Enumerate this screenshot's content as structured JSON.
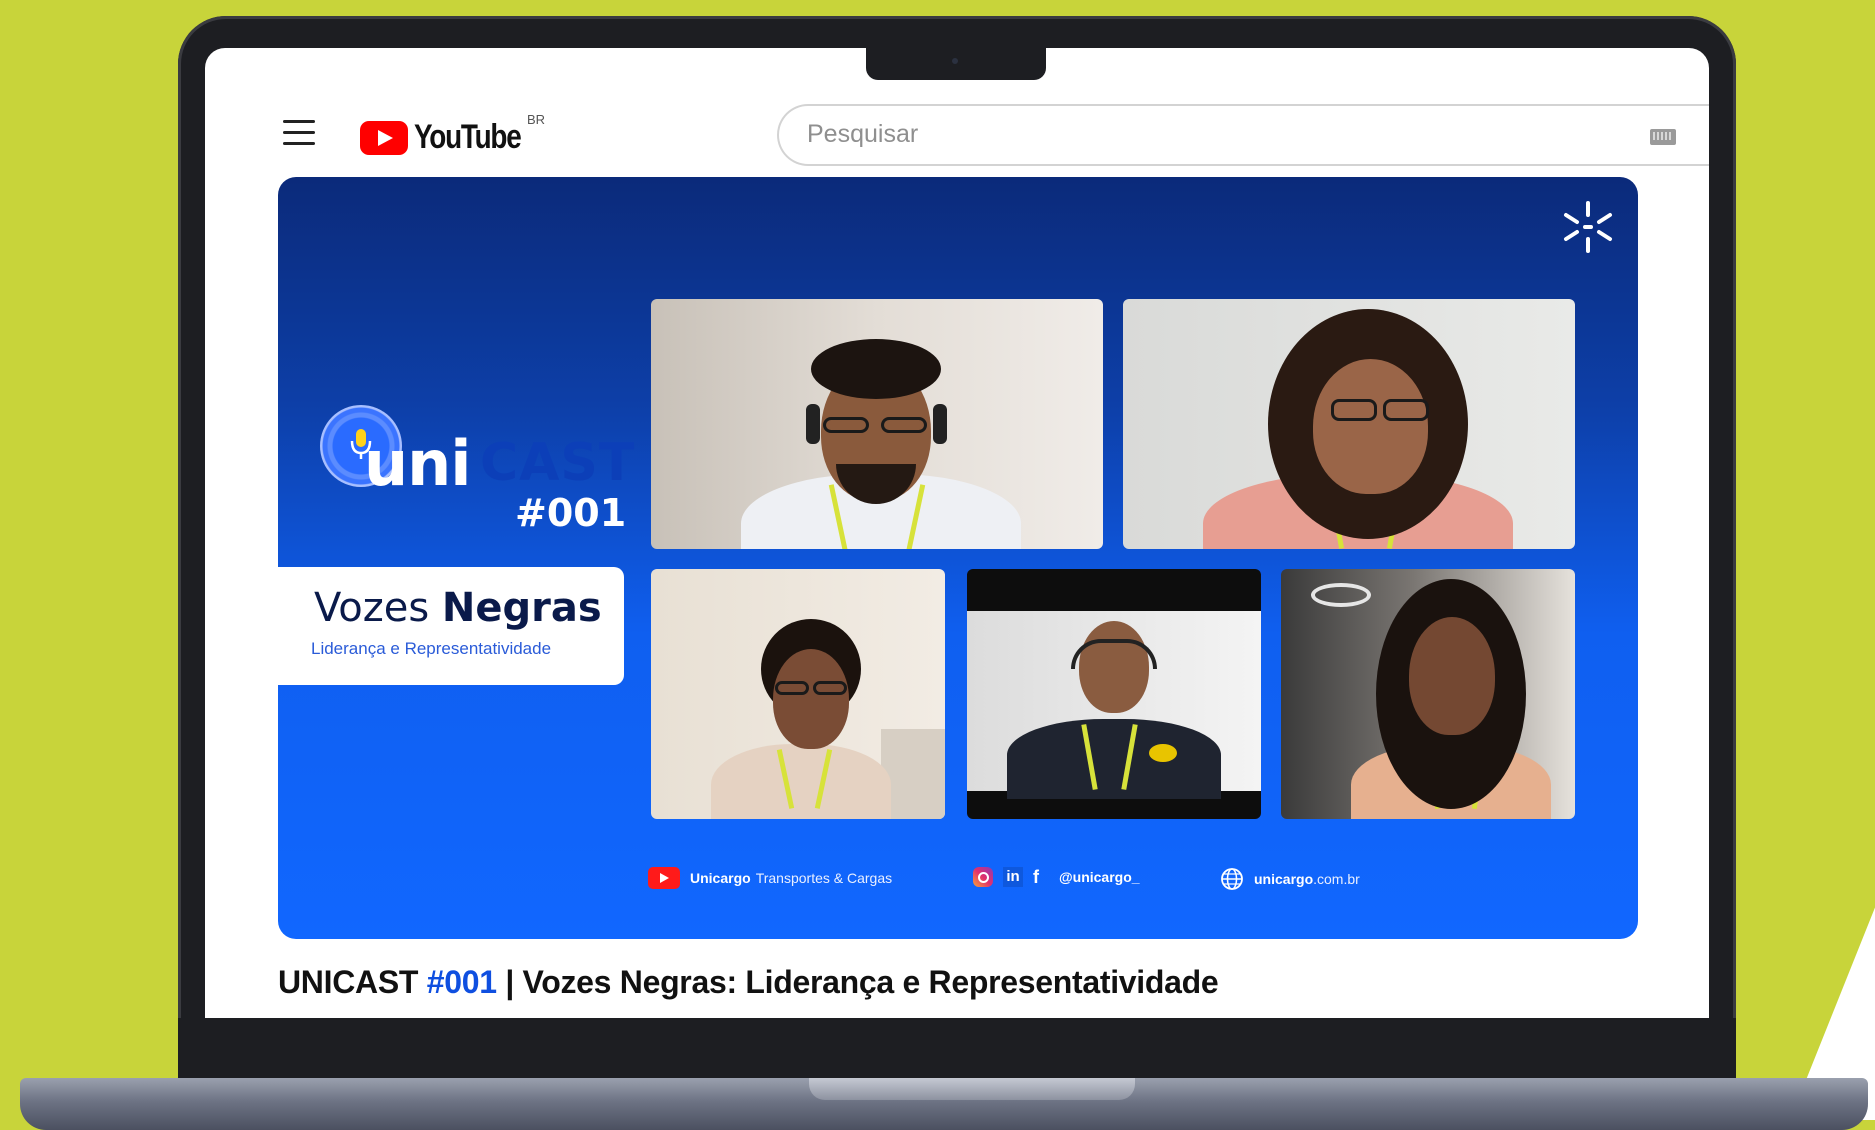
{
  "colors": {
    "background": "#c8d43a",
    "youtube_red": "#ff0000",
    "thumbnail_blue": "#0f5ff0",
    "accent_blue": "#0f4fe0",
    "lanyard_yellow": "#d7e23a"
  },
  "header": {
    "logo_text": "YouTube",
    "country_code": "BR",
    "search_placeholder": "Pesquisar",
    "icons": [
      "menu-icon",
      "youtube-logo-icon",
      "keyboard-icon"
    ]
  },
  "thumbnail": {
    "brand_uni": "uni",
    "brand_cast": "CAST",
    "episode": "#001",
    "title_main": "Vozes",
    "title_bold": "Negras",
    "subtitle": "Liderança e Representatividade",
    "participants": 5,
    "socials": {
      "youtube_brand": "Unicargo",
      "youtube_rest": "Transportes & Cargas",
      "linkedin_label": "in",
      "facebook_label": "f",
      "handle": "@unicargo_",
      "site_brand": "unicargo",
      "site_rest": ".com.br"
    }
  },
  "video": {
    "title_prefix": "UNICAST",
    "title_episode": "#001",
    "title_rest": "| Vozes Negras: Liderança e Representatividade"
  }
}
